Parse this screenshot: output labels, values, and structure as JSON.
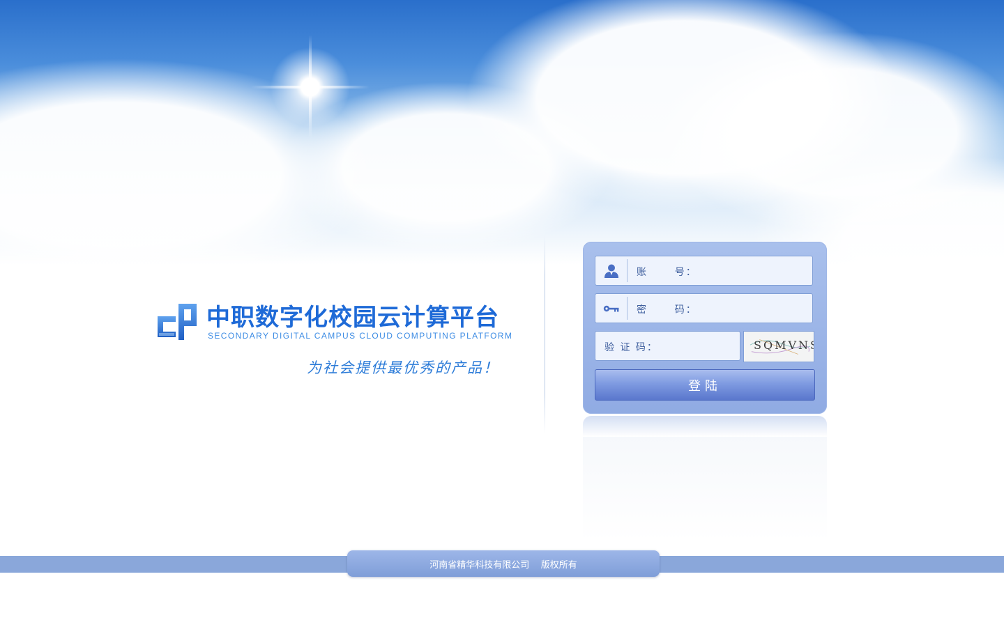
{
  "brand": {
    "title": "中职数字化校园云计算平台",
    "subtitle": "SECONDARY DIGITAL CAMPUS CLOUD COMPUTING PLATFORM",
    "slogan": "为社会提供最优秀的产品！"
  },
  "login": {
    "account_label": "账      号：",
    "account_value": "",
    "password_label": "密      码：",
    "password_value": "",
    "captcha_label": "验 证 码：",
    "captcha_value": "",
    "captcha_image_text": "SQMVNS",
    "submit_label": "登陆"
  },
  "icons": {
    "account": "user-icon",
    "password": "key-icon"
  },
  "colors": {
    "brand_blue": "#1e6ad7",
    "panel": "#a0b8ea",
    "button": "#6f8bd6",
    "footer": "#8aa7da"
  },
  "footer": {
    "copyright": "河南省精华科技有限公司    版权所有"
  }
}
